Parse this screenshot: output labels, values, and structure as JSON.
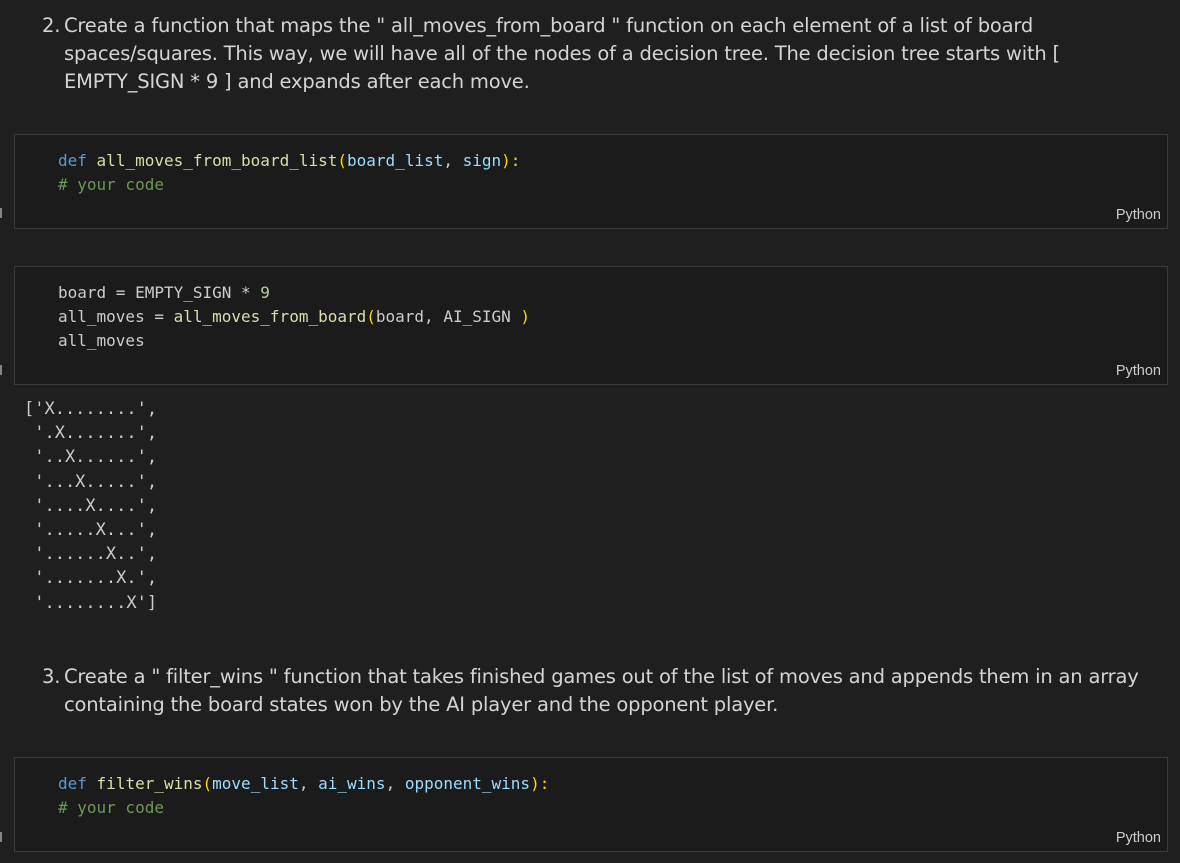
{
  "markdown": {
    "step2": {
      "number": "2.",
      "text": "Create a function that maps the \" all_moves_from_board \" function on each element of a list of board spaces/squares. This way, we will have all of the nodes of a decision tree. The decision tree starts with [ EMPTY_SIGN * 9 ] and expands after each move."
    },
    "step3": {
      "number": "3.",
      "text": "Create a \" filter_wins \" function that takes finished games out of the list of moves and appends them in an array containing the board states won by the AI player and the opponent player."
    }
  },
  "cells": {
    "cell1": {
      "def_kw": "def",
      "fn_name": "all_moves_from_board_list",
      "open_paren": "(",
      "param1": "board_list",
      "sep": ", ",
      "param2": "sign",
      "close": "):",
      "comment": "# your code",
      "language": "Python"
    },
    "cell2": {
      "line1_var": "board",
      "line1_op": " = EMPTY_SIGN * ",
      "line1_num": "9",
      "line2_lhs": "all_moves = ",
      "line2_fn": "all_moves_from_board",
      "line2_open": "(",
      "line2_args": "board, AI_SIGN ",
      "line2_close": ")",
      "line3": "all_moves",
      "language": "Python"
    },
    "cell3": {
      "def_kw": "def",
      "fn_name": "filter_wins",
      "open_paren": "(",
      "param1": "move_list",
      "sep1": ", ",
      "param2": "ai_wins",
      "sep2": ", ",
      "param3": "opponent_wins",
      "close": "):",
      "comment": "# your code",
      "language": "Python"
    }
  },
  "output": {
    "lines": [
      "['X........',",
      " '.X.......',",
      " '..X......',",
      " '...X.....',",
      " '....X....',",
      " '.....X...',",
      " '......X..',",
      " '.......X.',",
      " '........X']"
    ]
  },
  "colors": {
    "background": "#1f1f1f",
    "cell_background": "#1b1b1b",
    "keyword": "#569cd6",
    "function": "#dcdcaa",
    "parameter": "#9cdcfe",
    "bracket": "#ffd700",
    "comment": "#6a9955",
    "number": "#b5cea8"
  }
}
